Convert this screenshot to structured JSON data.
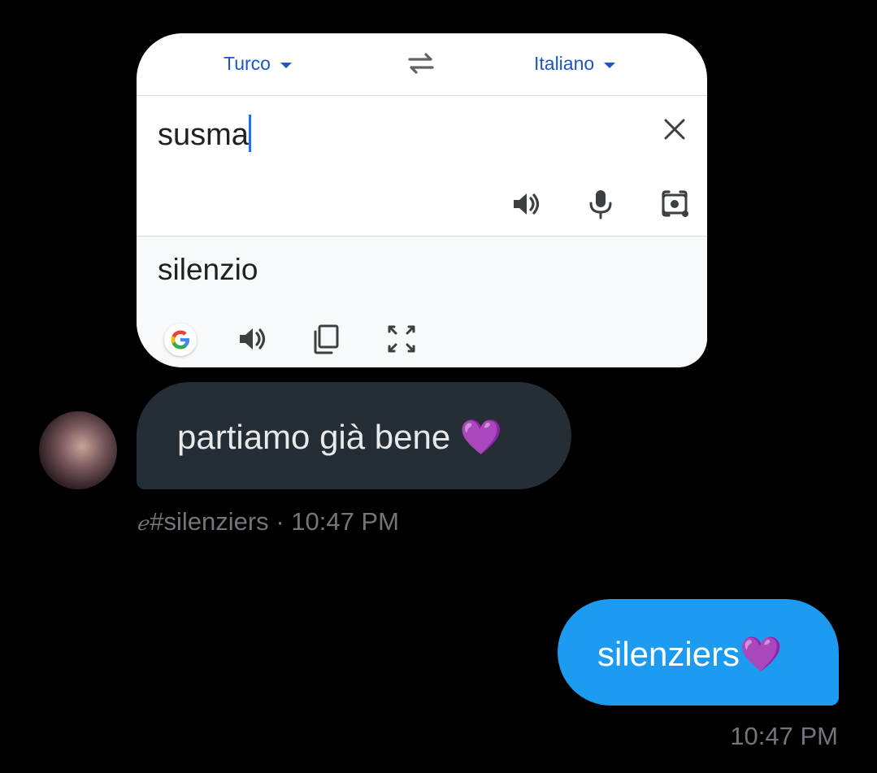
{
  "translate_card": {
    "source_language": "Turco",
    "target_language": "Italiano",
    "input_text": "susma",
    "output_text": "silenzio",
    "icons": {
      "swap": "swap-arrows-icon",
      "clear": "close-icon",
      "input_listen": "speaker-icon",
      "input_mic": "microphone-icon",
      "input_camera": "camera-lens-icon",
      "output_logo": "google-g-logo",
      "output_listen": "speaker-icon",
      "output_copy": "copy-icon",
      "output_fullscreen": "fullscreen-icon"
    },
    "colors": {
      "link_blue": "#1a56c4",
      "cursor": "#1a73e8"
    }
  },
  "received_message": {
    "text": "partiamo già bene",
    "emoji": "💜",
    "sender_script": "ℯ",
    "sender_handle": "#silenziers",
    "separator": "·",
    "time": "10:47 PM"
  },
  "sent_message": {
    "text": "silenziers",
    "emoji": "💜",
    "time": "10:47 PM"
  },
  "colors": {
    "background": "#000000",
    "received_bubble": "#252d35",
    "sent_bubble": "#1d9bf0",
    "meta_text": "#71767b"
  }
}
